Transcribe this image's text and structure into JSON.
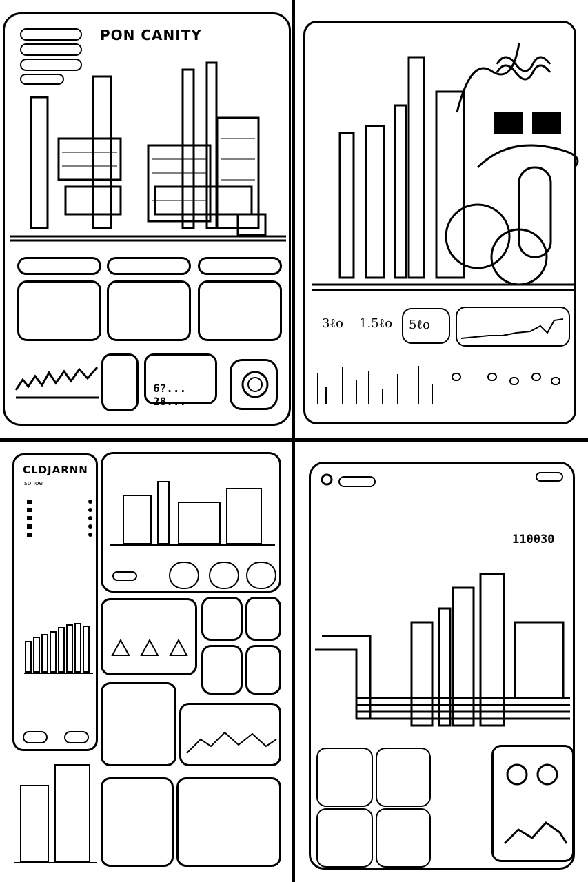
{
  "panel_tl": {
    "title": "PON CANITY",
    "big_readout": "6?... 28..."
  },
  "panel_tr": {
    "stats": [
      "3ℓo",
      "1.5ℓo",
      "5ℓo"
    ]
  },
  "panel_bl": {
    "title": "CLDJARNN",
    "subtitle": "sonoe"
  },
  "panel_br": {
    "readout": "110030"
  }
}
